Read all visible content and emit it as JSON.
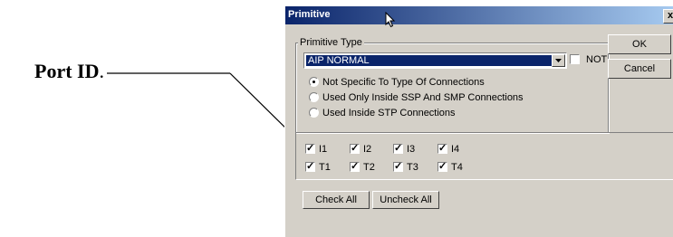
{
  "annotation": {
    "label": "Port ID",
    "suffix": "."
  },
  "dialog": {
    "title": "Primitive",
    "close_label": "x",
    "primitive_type": {
      "group_title": "Primitive Type",
      "selected_value": "AIP NORMAL",
      "not_checked": false,
      "not_label": "NOT"
    },
    "connection_options": [
      {
        "label": "Not Specific To Type Of Connections",
        "selected": true
      },
      {
        "label": "Used Only Inside SSP And SMP Connections",
        "selected": false
      },
      {
        "label": "Used Inside STP Connections",
        "selected": false
      }
    ],
    "ports": {
      "i1": "I1",
      "i2": "I2",
      "i3": "I3",
      "i4": "I4",
      "t1": "T1",
      "t2": "T2",
      "t3": "T3",
      "t4": "T4"
    },
    "buttons": {
      "ok": "OK",
      "cancel": "Cancel",
      "check_all": "Check All",
      "uncheck_all": "Uncheck All"
    }
  }
}
